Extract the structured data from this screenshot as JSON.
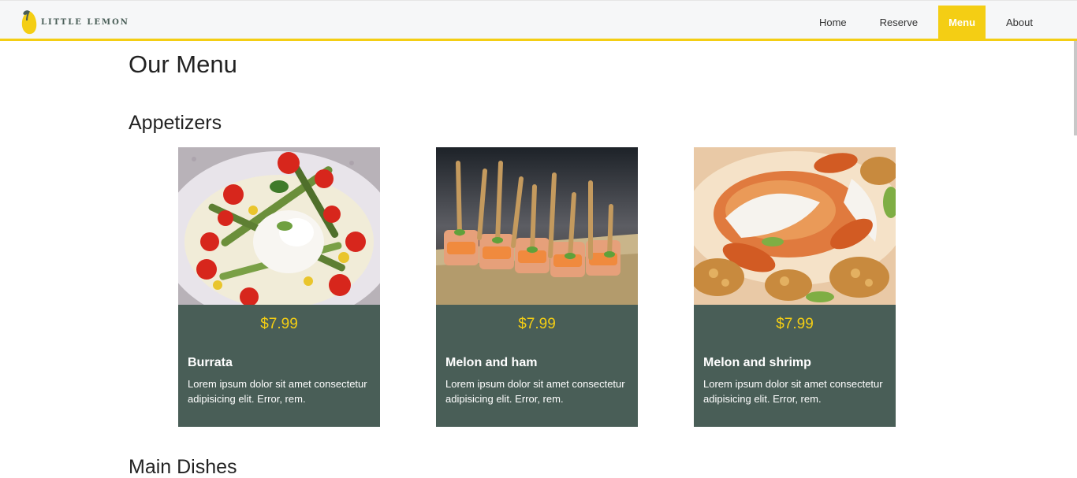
{
  "header": {
    "logo_text": "LITTLE LEMON",
    "nav": [
      {
        "label": "Home"
      },
      {
        "label": "Reserve"
      },
      {
        "label": "Menu",
        "active": true
      },
      {
        "label": "About"
      }
    ]
  },
  "page": {
    "title": "Our Menu"
  },
  "sections": [
    {
      "title": "Appetizers",
      "items": [
        {
          "price": "$7.99",
          "name": "Burrata",
          "description": "Lorem ipsum dolor sit amet consectetur adipisicing elit. Error, rem."
        },
        {
          "price": "$7.99",
          "name": "Melon and ham",
          "description": "Lorem ipsum dolor sit amet consectetur adipisicing elit. Error, rem."
        },
        {
          "price": "$7.99",
          "name": "Melon and shrimp",
          "description": "Lorem ipsum dolor sit amet consectetur adipisicing elit. Error, rem."
        }
      ]
    },
    {
      "title": "Main Dishes",
      "items": []
    }
  ],
  "colors": {
    "brand_yellow": "#f4ce14",
    "brand_green": "#495e57",
    "navbar_bg": "#f6f7f8"
  }
}
